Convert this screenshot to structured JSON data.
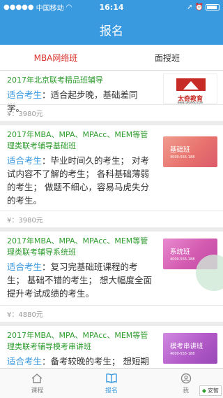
{
  "status": {
    "carrier": "中国移动",
    "time": "16:14"
  },
  "header": {
    "title": "报名"
  },
  "tabs": [
    {
      "label": "MBA网络班",
      "active": true
    },
    {
      "label": "面授班",
      "active": false
    }
  ],
  "courses": [
    {
      "title": "2017年北京联考精品班辅导",
      "label": "适合考生",
      "desc": "：适合起步晚，基础差同学。",
      "price": "¥：3980元",
      "thumb": {
        "kind": "logo",
        "text": "太奇教育",
        "url": "www.taiqiedu.com"
      }
    },
    {
      "title": "2017年MBA、MPA、MPAcc、MEM等管理类联考辅导基础班",
      "label": "适合考生",
      "desc": "：毕业时间久的考生； 对考试内容不了解的考生； 各科基础薄弱的考生； 做题不细心，容易马虎失分的考生。",
      "price": "¥：3980元",
      "thumb": {
        "kind": "class",
        "text": "基础班",
        "phone": "4000-555-188",
        "color": "#e8736e"
      }
    },
    {
      "title": "2017年MBA、MPA、MPAcc、MEM等管理类联考辅导系统班",
      "label": "适合考生",
      "desc": "：复习完基础班课程的考生； 基础不错的考生； 想大幅度全面提升考试成绩的考生。",
      "price": "¥：4880元",
      "thumb": {
        "kind": "class",
        "text": "系统班",
        "phone": "4000-555-188",
        "color": "#d35bb0"
      }
    },
    {
      "title": "2017年MBA、MPA、MPAcc、MEM等管理类联考辅导模考串讲班",
      "label": "适合考生",
      "desc": "：备考较晚的考生； 想短期大",
      "price": "",
      "thumb": {
        "kind": "class",
        "text": "模考串讲班",
        "phone": "4000-555-188",
        "color": "#b25ac8"
      }
    }
  ],
  "tabbar": [
    {
      "label": "课程",
      "icon": "home-icon",
      "active": false
    },
    {
      "label": "报名",
      "icon": "book-icon",
      "active": true
    },
    {
      "label": "我",
      "icon": "user-icon",
      "active": false
    }
  ],
  "watermark": "安智",
  "colors": {
    "primary": "#3a9ae0",
    "active_tab": "#d9332c",
    "title_green": "#2e9c2e"
  }
}
